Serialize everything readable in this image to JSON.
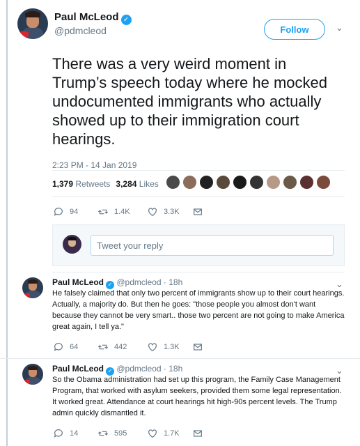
{
  "main_tweet": {
    "author_name": "Paul McLeod",
    "author_handle": "@pdmcleod",
    "follow_label": "Follow",
    "text": "There was a very weird moment in Trump’s speech today where he mocked undocumented immigrants who actually showed up to their immigration court hearings.",
    "timestamp": "2:23 PM - 14 Jan 2019",
    "retweets_count": "1,379",
    "retweets_label": "Retweets",
    "likes_count": "3,284",
    "likes_label": "Likes",
    "actions": {
      "replies": "94",
      "retweets": "1.4K",
      "likes": "3.3K"
    }
  },
  "reply_box": {
    "placeholder": "Tweet your reply"
  },
  "thread": [
    {
      "author_name": "Paul McLeod",
      "author_handle": "@pdmcleod",
      "age": "18h",
      "text": "He falsely claimed that only two percent of immigrants show up to their court hearings. Actually, a majority do. But then he goes: \"those people you almost don't want because they cannot be very smart.. those two percent are not going to make America great again, I tell ya.\"",
      "actions": {
        "replies": "64",
        "retweets": "442",
        "likes": "1.3K"
      }
    },
    {
      "author_name": "Paul McLeod",
      "author_handle": "@pdmcleod",
      "age": "18h",
      "text": "So the Obama administration had set up this program, the Family Case Management Program, that worked with asylum seekers, provided them some legal representation. It worked great. Attendance at court hearings hit high-90s percent levels. The Trump admin quickly dismantled it.",
      "actions": {
        "replies": "14",
        "retweets": "595",
        "likes": "1.7K"
      }
    }
  ],
  "colors": {
    "accent": "#1da1f2",
    "text_primary": "#14171a",
    "text_secondary": "#657786",
    "thread_line": "#c4cfd6"
  },
  "icons": {
    "verified": "check-badge",
    "reply": "speech-bubble",
    "retweet": "arrows-loop",
    "like": "heart",
    "message": "envelope",
    "menu": "chevron-down"
  }
}
